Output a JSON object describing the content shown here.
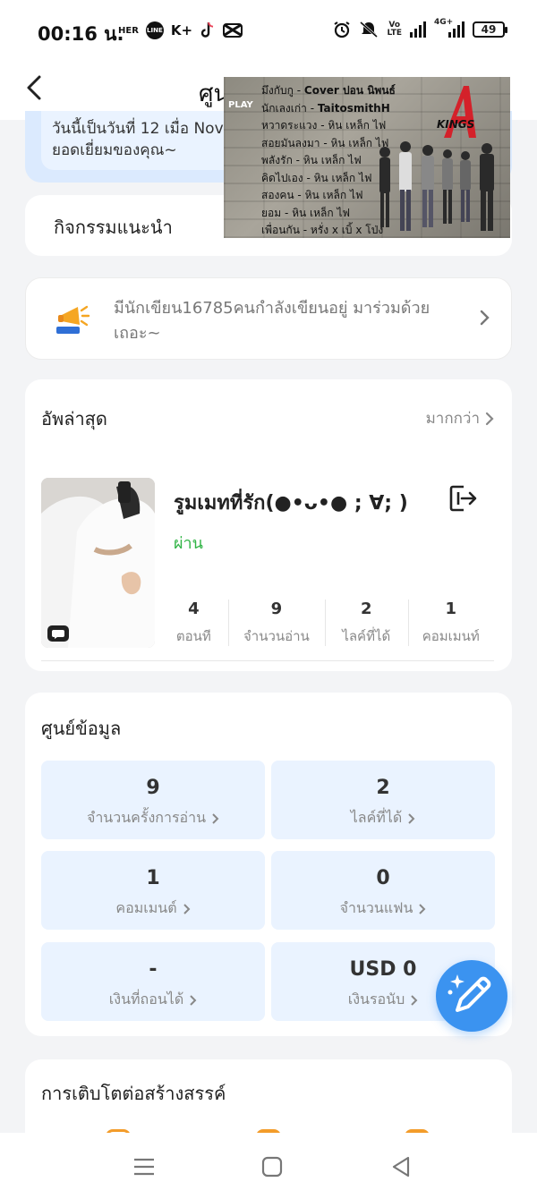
{
  "status_bar": {
    "time": "00:16 น.",
    "left_icons": [
      "HER",
      "LINE",
      "K+",
      "tiktok-icon",
      "capcut-icon"
    ],
    "volte": "VoLTE",
    "network": "4G+",
    "battery": "49"
  },
  "header": {
    "title": "ศูน"
  },
  "video_overlay": {
    "play_label": "PLAY",
    "logo_text": "KINGS",
    "tracks": [
      {
        "song": "มึงกับกู - ",
        "artist": "Cover ปอน นิพนธ์"
      },
      {
        "song": "นักเลงเก่า - ",
        "artist": "TaitosmithH"
      },
      {
        "song": "หวาดระแวง - ",
        "artist": "หิน เหล็ก ไฟ"
      },
      {
        "song": "สอยมันลงมา - ",
        "artist": "หิน เหล็ก ไฟ"
      },
      {
        "song": "พลังรัก - ",
        "artist": "หิน เหล็ก ไฟ"
      },
      {
        "song": "คิดไปเอง - ",
        "artist": "หิน เหล็ก ไฟ"
      },
      {
        "song": "สองคน - ",
        "artist": "หิน เหล็ก ไฟ"
      },
      {
        "song": "ยอม - ",
        "artist": "หิน เหล็ก ไฟ"
      },
      {
        "song": "เพื่อนกัน - ",
        "artist": "หรั่ง x เบิ้ x โป่ง"
      }
    ]
  },
  "welcome": {
    "line1": "วันนี้เป็นวันที่ 12 เมื่อ Nov",
    "line2": "ยอดเยี่ยมของคุณ~"
  },
  "recommended_activity": {
    "title": "กิจกรรมแนะนำ"
  },
  "writers_banner": {
    "text": "มีนักเขียน16785คนกำลังเขียนอยู่ มาร่วมด้วยเถอะ~"
  },
  "latest": {
    "title": "อัพล่าสุด",
    "more_label": "มากกว่า",
    "story": {
      "title": "รูมเมทที่รัก(●•ᴗ•● ;  ∀; )",
      "status": "ผ่าน",
      "stats": [
        {
          "value": "4",
          "label": "ตอนที"
        },
        {
          "value": "9",
          "label": "จำนวนอ่าน"
        },
        {
          "value": "2",
          "label": "ไลค์ที่ได้"
        },
        {
          "value": "1",
          "label": "คอมเมนท์"
        }
      ]
    }
  },
  "data_center": {
    "title": "ศูนย์ข้อมูล",
    "tiles": [
      {
        "value": "9",
        "label": "จำนวนครั้งการอ่าน"
      },
      {
        "value": "2",
        "label": "ไลค์ที่ได้"
      },
      {
        "value": "1",
        "label": "คอมเมนต์"
      },
      {
        "value": "0",
        "label": "จำนวนแฟน"
      },
      {
        "value": "-",
        "label": "เงินที่ถอนได้"
      },
      {
        "value": "USD 0",
        "label": "เงินรอนับ"
      }
    ]
  },
  "growth": {
    "title": "การเติบโตต่อสร้างสรรค์"
  },
  "colors": {
    "accent": "#3b93f0",
    "status_pass": "#2fb344",
    "tile_bg": "#eaf3ff"
  }
}
